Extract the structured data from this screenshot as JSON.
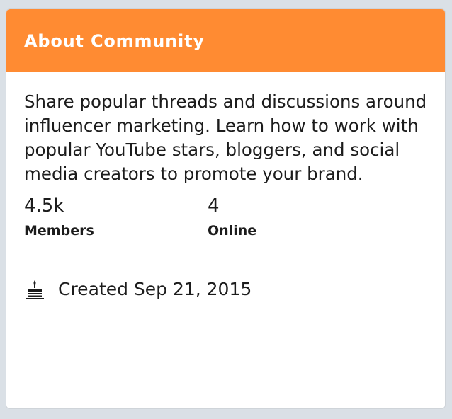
{
  "card": {
    "title": "About Community",
    "header_color": "#ff8b32",
    "description": "Share popular threads and discussions around influencer marketing. Learn how to work with popular YouTube stars, bloggers, and social media creators to promote your brand."
  },
  "stats": [
    {
      "value": "4.5k",
      "label": "Members"
    },
    {
      "value": "4",
      "label": "Online"
    }
  ],
  "created": {
    "icon": "cake-icon",
    "text": "Created Sep 21, 2015"
  }
}
